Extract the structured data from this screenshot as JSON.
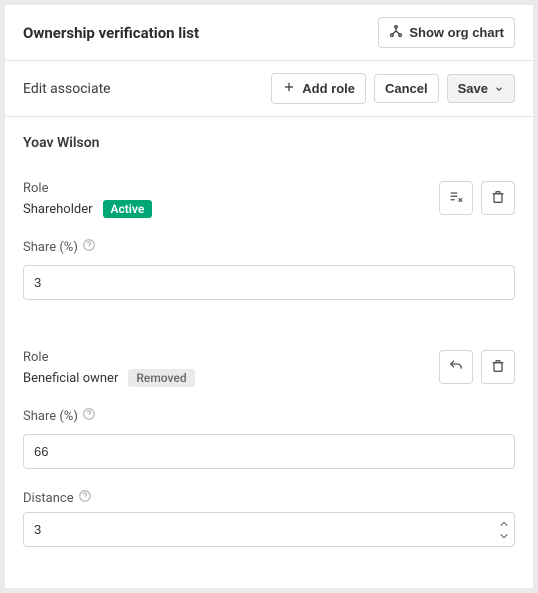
{
  "header": {
    "title": "Ownership verification list",
    "showOrgChart": "Show org chart"
  },
  "subheader": {
    "title": "Edit associate",
    "addRole": "Add role",
    "cancel": "Cancel",
    "save": "Save"
  },
  "associate": {
    "name": "Yoav Wilson"
  },
  "labels": {
    "role": "Role",
    "share": "Share (%)",
    "distance": "Distance"
  },
  "roles": [
    {
      "value": "Shareholder",
      "status": "Active",
      "statusType": "active",
      "share": "3"
    },
    {
      "value": "Beneficial owner",
      "status": "Removed",
      "statusType": "removed",
      "share": "66",
      "distance": "3"
    }
  ]
}
